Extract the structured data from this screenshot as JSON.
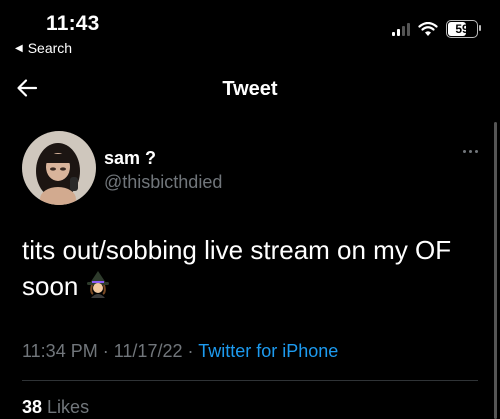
{
  "status_bar": {
    "time": "11:43",
    "back_label": "Search",
    "battery_level": "59"
  },
  "nav": {
    "title": "Tweet"
  },
  "tweet": {
    "display_name": "sam ?",
    "handle": "@thisbicthdied",
    "text": "tits out/sobbing live stream on my OF soon",
    "emoji": "witch-emoji",
    "time": "11:34 PM",
    "date": "11/17/22",
    "separator": "·",
    "source": "Twitter for iPhone",
    "likes_count": "38",
    "likes_label": "Likes"
  },
  "colors": {
    "background": "#000000",
    "secondary_text": "#71767b",
    "link": "#1d9bf0",
    "divider": "#2f3336"
  }
}
